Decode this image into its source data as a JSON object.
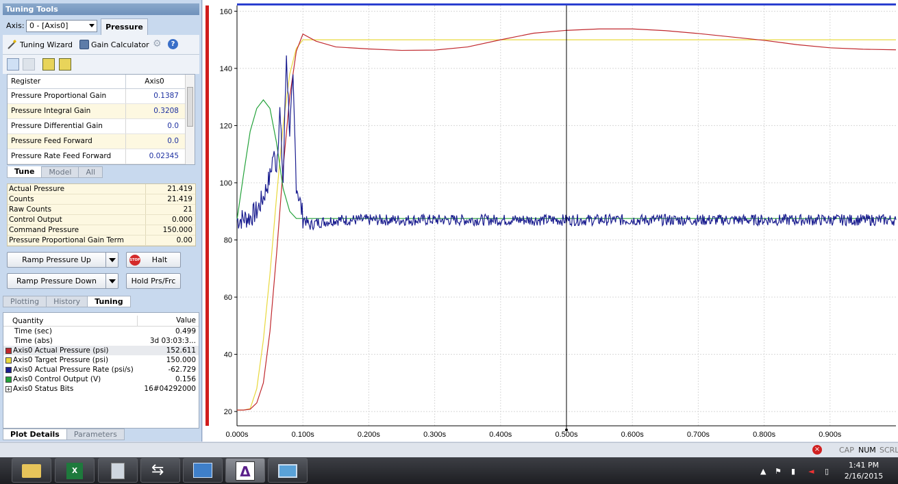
{
  "tuning_tools": {
    "title": "Tuning Tools",
    "axis_label": "Axis:",
    "axis_value": "0 - [Axis0]",
    "tab_label": "Pressure",
    "tuning_wizard": "Tuning Wizard",
    "gain_calculator": "Gain Calculator",
    "table_header": {
      "register": "Register",
      "axis": "Axis0"
    },
    "registers": [
      {
        "name": "Pressure Proportional Gain",
        "value": "0.1387"
      },
      {
        "name": "Pressure Integral Gain",
        "value": "0.3208"
      },
      {
        "name": "Pressure Differential Gain",
        "value": "0.0"
      },
      {
        "name": "Pressure Feed Forward",
        "value": "0.0"
      },
      {
        "name": "Pressure Rate Feed Forward",
        "value": "0.02345"
      }
    ],
    "subtabs": [
      "Tune",
      "Model",
      "All"
    ],
    "status": [
      {
        "name": "Actual Pressure",
        "value": "21.419"
      },
      {
        "name": "Counts",
        "value": "21.419"
      },
      {
        "name": "Raw Counts",
        "value": "21"
      },
      {
        "name": "Control Output",
        "value": "0.000"
      },
      {
        "name": "Command Pressure",
        "value": "150.000"
      },
      {
        "name": "Pressure Proportional Gain Term",
        "value": "0.00"
      }
    ],
    "buttons": {
      "ramp_up": "Ramp Pressure Up",
      "ramp_down": "Ramp Pressure Down",
      "halt": "Halt",
      "stop_text": "STOP",
      "hold": "Hold Prs/Frc"
    },
    "bottom_tabs": [
      "Plotting",
      "History",
      "Tuning"
    ]
  },
  "plot_details": {
    "header": {
      "quantity": "Quantity",
      "value": "Value"
    },
    "rows": [
      {
        "name": "Time (sec)",
        "value": "0.499",
        "color": ""
      },
      {
        "name": "Time (abs)",
        "value": "3d 03:03:3...",
        "color": ""
      },
      {
        "name": "Axis0 Actual Pressure (psi)",
        "value": "152.611",
        "color": "#c0282d"
      },
      {
        "name": "Axis0 Target Pressure (psi)",
        "value": "150.000",
        "color": "#e8d83c"
      },
      {
        "name": "Axis0 Actual Pressure Rate (psi/s)",
        "value": "-62.729",
        "color": "#1a1d8f"
      },
      {
        "name": "Axis0 Control Output (V)",
        "value": "0.156",
        "color": "#23a23a"
      },
      {
        "name": "Axis0 Status Bits",
        "value": "16#04292000",
        "color": "plus"
      }
    ],
    "tabs": [
      "Plot Details",
      "Parameters"
    ]
  },
  "status_bar": {
    "cap": "CAP",
    "num": "NUM",
    "scrl": "SCRL"
  },
  "taskbar": {
    "time": "1:41 PM",
    "date": "2/16/2015"
  },
  "chart_data": {
    "type": "line",
    "xlim": [
      0,
      1.0
    ],
    "ylim": [
      15,
      162
    ],
    "x_ticks": [
      {
        "v": 0.0,
        "label": "0.000s"
      },
      {
        "v": 0.1,
        "label": "0.100s"
      },
      {
        "v": 0.2,
        "label": "0.200s"
      },
      {
        "v": 0.3,
        "label": "0.300s"
      },
      {
        "v": 0.4,
        "label": "0.400s"
      },
      {
        "v": 0.5,
        "label": "0.500s"
      },
      {
        "v": 0.6,
        "label": "0.600s"
      },
      {
        "v": 0.7,
        "label": "0.700s"
      },
      {
        "v": 0.8,
        "label": "0.800s"
      },
      {
        "v": 0.9,
        "label": "0.900s"
      }
    ],
    "y_ticks": [
      20,
      40,
      60,
      80,
      100,
      120,
      140,
      160
    ],
    "cursor_x": 0.5,
    "grid": true,
    "series": [
      {
        "name": "Axis0 Target Pressure (psi)",
        "color": "#e8d83c",
        "x": [
          0,
          0.01,
          0.02,
          0.03,
          0.04,
          0.05,
          0.06,
          0.07,
          0.08,
          0.09,
          0.1,
          1.0
        ],
        "y": [
          20.5,
          20.5,
          21,
          28,
          45,
          68,
          95,
          120,
          138,
          147,
          150,
          150
        ]
      },
      {
        "name": "Axis0 Actual Pressure (psi)",
        "color": "#c0282d",
        "x": [
          0,
          0.01,
          0.02,
          0.03,
          0.04,
          0.05,
          0.06,
          0.07,
          0.08,
          0.09,
          0.1,
          0.12,
          0.15,
          0.2,
          0.25,
          0.3,
          0.35,
          0.4,
          0.45,
          0.5,
          0.55,
          0.6,
          0.65,
          0.7,
          0.75,
          0.8,
          0.85,
          0.9,
          0.95,
          1.0
        ],
        "y": [
          20.5,
          20.5,
          20.8,
          23,
          30,
          48,
          75,
          105,
          130,
          146,
          152,
          149.5,
          147.5,
          146.8,
          146.3,
          146.4,
          147.5,
          150,
          152.3,
          153.3,
          153.8,
          153.8,
          153.2,
          152.2,
          151,
          149.8,
          148.3,
          147.2,
          146.7,
          146.5
        ]
      },
      {
        "name": "Axis0 Control Output (V)",
        "color": "#23a23a",
        "x": [
          0,
          0.01,
          0.02,
          0.03,
          0.04,
          0.05,
          0.06,
          0.07,
          0.08,
          0.09,
          0.1,
          1.0
        ],
        "y": [
          87,
          103,
          118,
          126,
          129,
          126,
          114,
          98,
          90,
          87.5,
          87.5,
          87.5
        ]
      },
      {
        "name": "Axis0 Actual Pressure Rate (psi/s)",
        "color": "#1a1d8f",
        "x": [
          0,
          0.02,
          0.03,
          0.04,
          0.05,
          0.055,
          0.06,
          0.065,
          0.07,
          0.075,
          0.08,
          0.085,
          0.09,
          0.1,
          0.11,
          0.12,
          0.15,
          0.2,
          0.3,
          0.4,
          0.5,
          0.6,
          0.7,
          0.8,
          0.9,
          1.0
        ],
        "y": [
          87,
          88,
          90,
          95,
          102,
          110,
          106,
          125,
          100,
          145,
          118,
          135,
          100,
          88,
          85,
          86,
          87,
          87,
          87,
          87,
          87,
          87,
          87,
          87,
          87,
          87
        ]
      }
    ]
  }
}
